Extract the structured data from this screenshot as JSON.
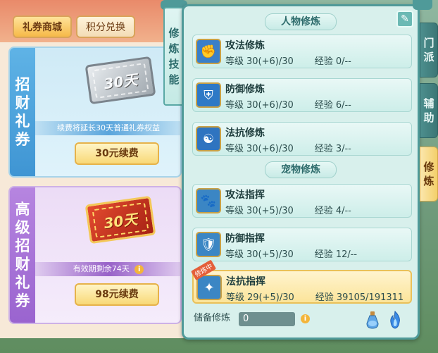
{
  "shop": {
    "tabs": [
      {
        "label": "礼券商城"
      },
      {
        "label": "积分兑换"
      }
    ],
    "cards": [
      {
        "side_title": [
          "招",
          "财",
          "礼",
          "券"
        ],
        "ticket_text": "30天",
        "note": "续费将延长30天普通礼券权益",
        "button": "30元续费"
      },
      {
        "side_title": [
          "高",
          "级",
          "招",
          "财",
          "礼",
          "券"
        ],
        "ticket_text": "30天",
        "note": "有效期剩余74天",
        "button": "98元续费"
      }
    ]
  },
  "skill_tab": [
    "修",
    "炼",
    "技",
    "能"
  ],
  "side_tabs": [
    {
      "chars": [
        "门",
        "派"
      ]
    },
    {
      "chars": [
        "辅",
        "助"
      ]
    },
    {
      "chars": [
        "修",
        "炼"
      ]
    }
  ],
  "panel": {
    "section_person": "人物修炼",
    "section_pet": "宠物修炼",
    "level_label": "等级",
    "exp_label": "经验",
    "person_rows": [
      {
        "name": "攻法修炼",
        "level": "30(+6)/30",
        "exp": "0/--",
        "icon": "fist-icon",
        "color": "#3a7fc8"
      },
      {
        "name": "防御修炼",
        "level": "30(+6)/30",
        "exp": "6/--",
        "icon": "shield-icon",
        "color": "#2e79c6"
      },
      {
        "name": "法抗修炼",
        "level": "30(+6)/30",
        "exp": "3/--",
        "icon": "yinyang-icon",
        "color": "#2f74c0"
      }
    ],
    "pet_rows": [
      {
        "name": "攻法指挥",
        "level": "30(+5)/30",
        "exp": "4/--",
        "icon": "paw-icon",
        "color": "#3b86c4"
      },
      {
        "name": "防御指挥",
        "level": "30(+5)/30",
        "exp": "12/--",
        "icon": "paw-shield-icon",
        "color": "#3b86c4"
      },
      {
        "name": "法抗指挥",
        "level": "29(+5)/30",
        "exp": "39105/191311",
        "icon": "paw-magic-icon",
        "color": "#3b86c4",
        "tag": "修炼中"
      }
    ],
    "footer": {
      "label": "储备修炼",
      "value": "0"
    }
  }
}
